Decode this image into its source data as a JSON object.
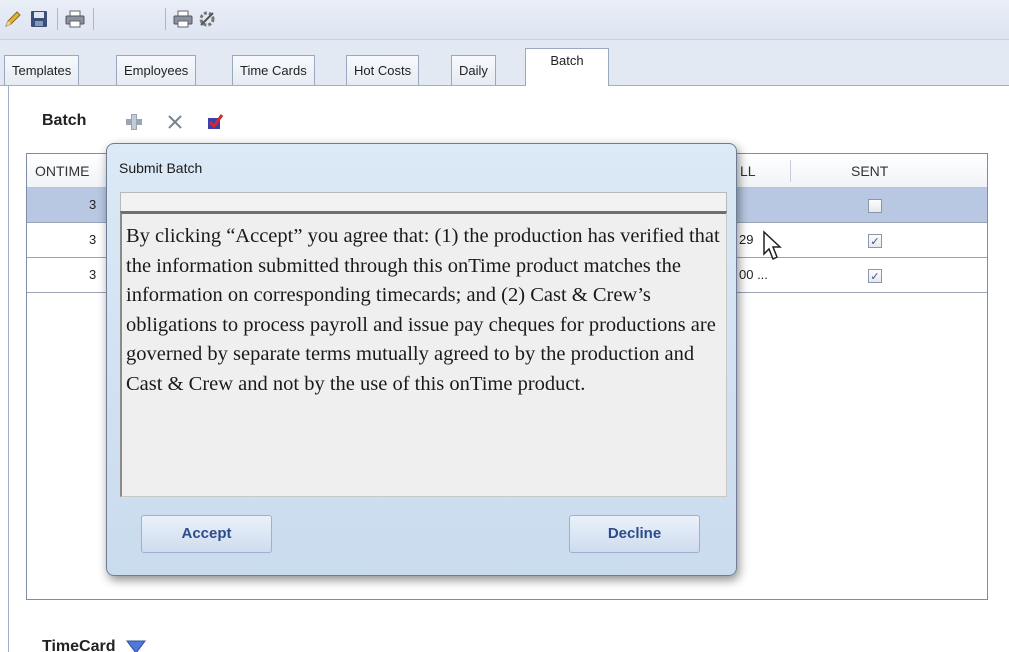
{
  "toolbar": {
    "icons": [
      "pencil-icon",
      "save-icon",
      "print-icon",
      "print-preview-icon",
      "tools-icon"
    ]
  },
  "tabs": [
    {
      "label": "Templates"
    },
    {
      "label": "Employees"
    },
    {
      "label": "Time Cards"
    },
    {
      "label": "Hot Costs"
    },
    {
      "label": "Daily"
    },
    {
      "label": "Batch"
    }
  ],
  "active_tab": "Batch",
  "batch_section": {
    "title": "Batch",
    "grid": {
      "headers": {
        "ontime": "ONTIME",
        "payroll": "LL",
        "sent": "SENT"
      },
      "rows": [
        {
          "ontime": "3",
          "payroll": "",
          "sent": false
        },
        {
          "ontime": "3",
          "payroll": "29",
          "sent": true
        },
        {
          "ontime": "3",
          "payroll": "00 ...",
          "sent": true
        }
      ]
    }
  },
  "timecard_section": {
    "title": "TimeCard"
  },
  "dialog": {
    "title": "Submit Batch",
    "message": "By clicking “Accept” you agree that: (1) the production has verified that the information submitted through this onTime product matches the information on corresponding timecards; and (2) Cast & Crew’s obligations to process payroll and issue pay cheques for productions are governed by separate terms mutually agreed to by the production and Cast & Crew and not by the use of this onTime product.",
    "accept_label": "Accept",
    "decline_label": "Decline"
  },
  "colors": {
    "selected_row": "#b8c8e2",
    "button_text": "#2c4c8c",
    "dialog_bg": "#d3e3f3"
  }
}
